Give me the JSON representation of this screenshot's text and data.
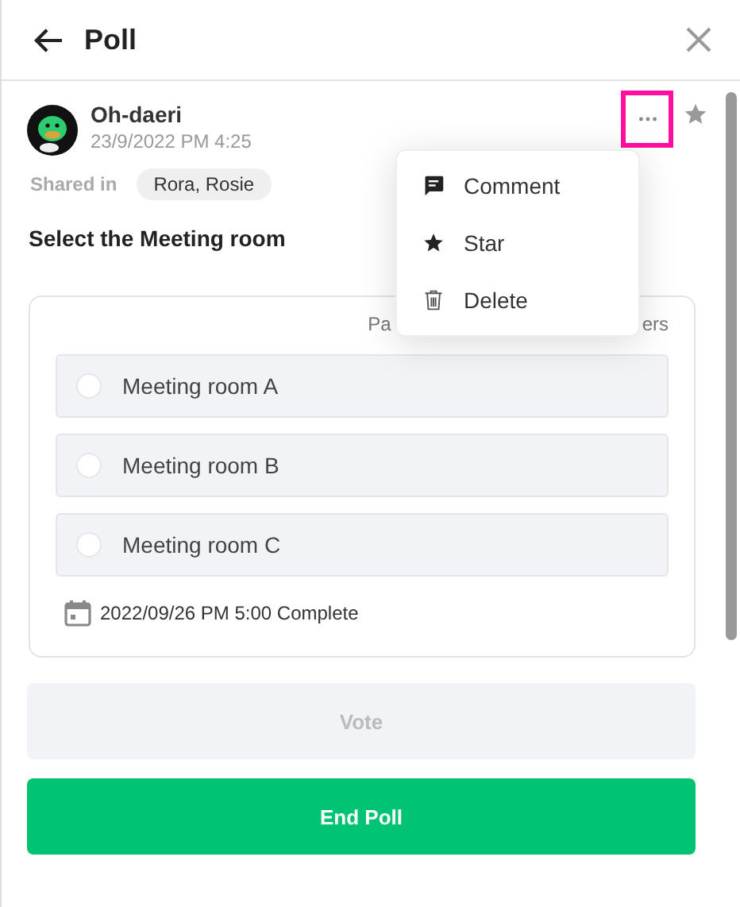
{
  "header": {
    "title": "Poll"
  },
  "post": {
    "author": "Oh-daeri",
    "timestamp": "23/9/2022 PM 4:25",
    "shared_label": "Shared in",
    "shared_with": "Rora, Rosie",
    "starred": false,
    "more_highlighted": true
  },
  "question": "Select the Meeting room",
  "poll": {
    "participants_fragments": [
      "Pa",
      "ers"
    ],
    "options": [
      {
        "label": "Meeting room A",
        "selected": false
      },
      {
        "label": "Meeting room B",
        "selected": false
      },
      {
        "label": "Meeting room C",
        "selected": false
      }
    ],
    "deadline": "2022/09/26 PM 5:00 Complete"
  },
  "vote_button": {
    "label": "Vote",
    "disabled": true
  },
  "end_button": {
    "label": "End Poll"
  },
  "menu": {
    "items": [
      {
        "kind": "comment",
        "label": "Comment"
      },
      {
        "kind": "star",
        "label": "Star"
      },
      {
        "kind": "delete",
        "label": "Delete"
      }
    ]
  }
}
